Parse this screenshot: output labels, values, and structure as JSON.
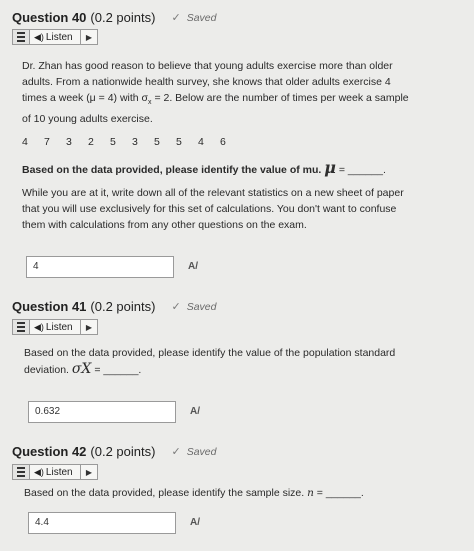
{
  "q40": {
    "title": "Question 40",
    "points": "(0.2 points)",
    "status": "Saved",
    "listen_label": "Listen",
    "para_1": "Dr. Zhan has good reason to believe that young adults exercise more than older",
    "para_2": "adults. From a nationwide health survey, she knows that older adults exercise 4",
    "para_3a": "times a week (μ = 4) with σ",
    "para_3_sub": "x",
    "para_3b": " = 2.  Below are the number of times per week a sample",
    "para_4": "of 10 young adults exercise.",
    "numbers": [
      "4",
      "7",
      "3",
      "2",
      "5",
      "3",
      "5",
      "5",
      "4",
      "6"
    ],
    "prompt": "Based on the data provided, please identify the value of mu.",
    "prompt_symbol": "μ",
    "prompt_blank": " = ______.",
    "note_1": "While you are at it, write down all of the relevant statistics on a new sheet of paper",
    "note_2": "that you will use exclusively for this set of calculations. You don't want to confuse",
    "note_3": "them with calculations from any other questions on the exam.",
    "answer": "4"
  },
  "q41": {
    "title": "Question 41",
    "points": "(0.2 points)",
    "status": "Saved",
    "listen_label": "Listen",
    "prompt_1": "Based on the data provided, please identify the value of the population standard",
    "prompt_2": "deviation.",
    "prompt_symbol": "σX",
    "prompt_blank": " = ______.",
    "answer": "0.632"
  },
  "q42": {
    "title": "Question 42",
    "points": "(0.2 points)",
    "status": "Saved",
    "listen_label": "Listen",
    "prompt": "Based on the data provided, please identify the sample size.",
    "prompt_symbol": "n",
    "prompt_blank": " = ______.",
    "answer": "4.4"
  },
  "icons": {
    "menu": "menu-icon",
    "speaker": "speaker-icon",
    "play": "play-icon",
    "check": "check-icon",
    "spellcheck": "spellcheck-icon"
  }
}
